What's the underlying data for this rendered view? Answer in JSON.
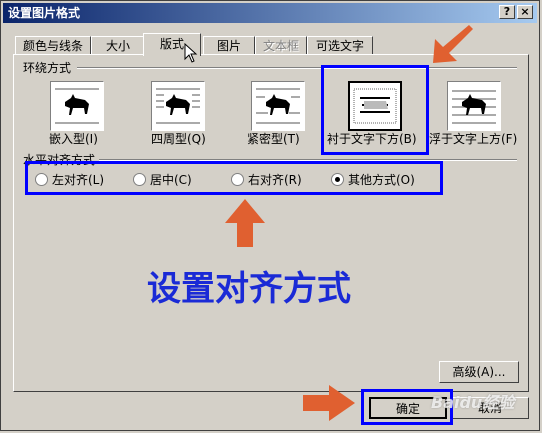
{
  "window": {
    "title": "设置图片格式",
    "help_label": "?",
    "close_label": "×"
  },
  "tabs": [
    {
      "label": "颜色与线条"
    },
    {
      "label": "大小"
    },
    {
      "label": "版式"
    },
    {
      "label": "图片"
    },
    {
      "label": "文本框"
    },
    {
      "label": "可选文字"
    }
  ],
  "wrap_group": {
    "label": "环绕方式",
    "options": [
      {
        "label": "嵌入型(I)",
        "icon": "inline-wrap-icon"
      },
      {
        "label": "四周型(Q)",
        "icon": "square-wrap-icon"
      },
      {
        "label": "紧密型(T)",
        "icon": "tight-wrap-icon"
      },
      {
        "label": "衬于文字下方(B)",
        "icon": "behind-text-icon"
      },
      {
        "label": "浮于文字上方(F)",
        "icon": "in-front-text-icon"
      }
    ]
  },
  "align_group": {
    "label": "水平对齐方式",
    "options": [
      {
        "label": "左对齐(L)",
        "checked": false
      },
      {
        "label": "居中(C)",
        "checked": false
      },
      {
        "label": "右对齐(R)",
        "checked": false
      },
      {
        "label": "其他方式(O)",
        "checked": true
      }
    ]
  },
  "buttons": {
    "advanced": "高级(A)...",
    "ok": "确定",
    "cancel": "取消"
  },
  "annotation": {
    "text": "设置对齐方式",
    "highlight_color": "#0000ff",
    "arrow_color": "#e06030"
  },
  "watermark": {
    "text": "Baidu经验"
  }
}
